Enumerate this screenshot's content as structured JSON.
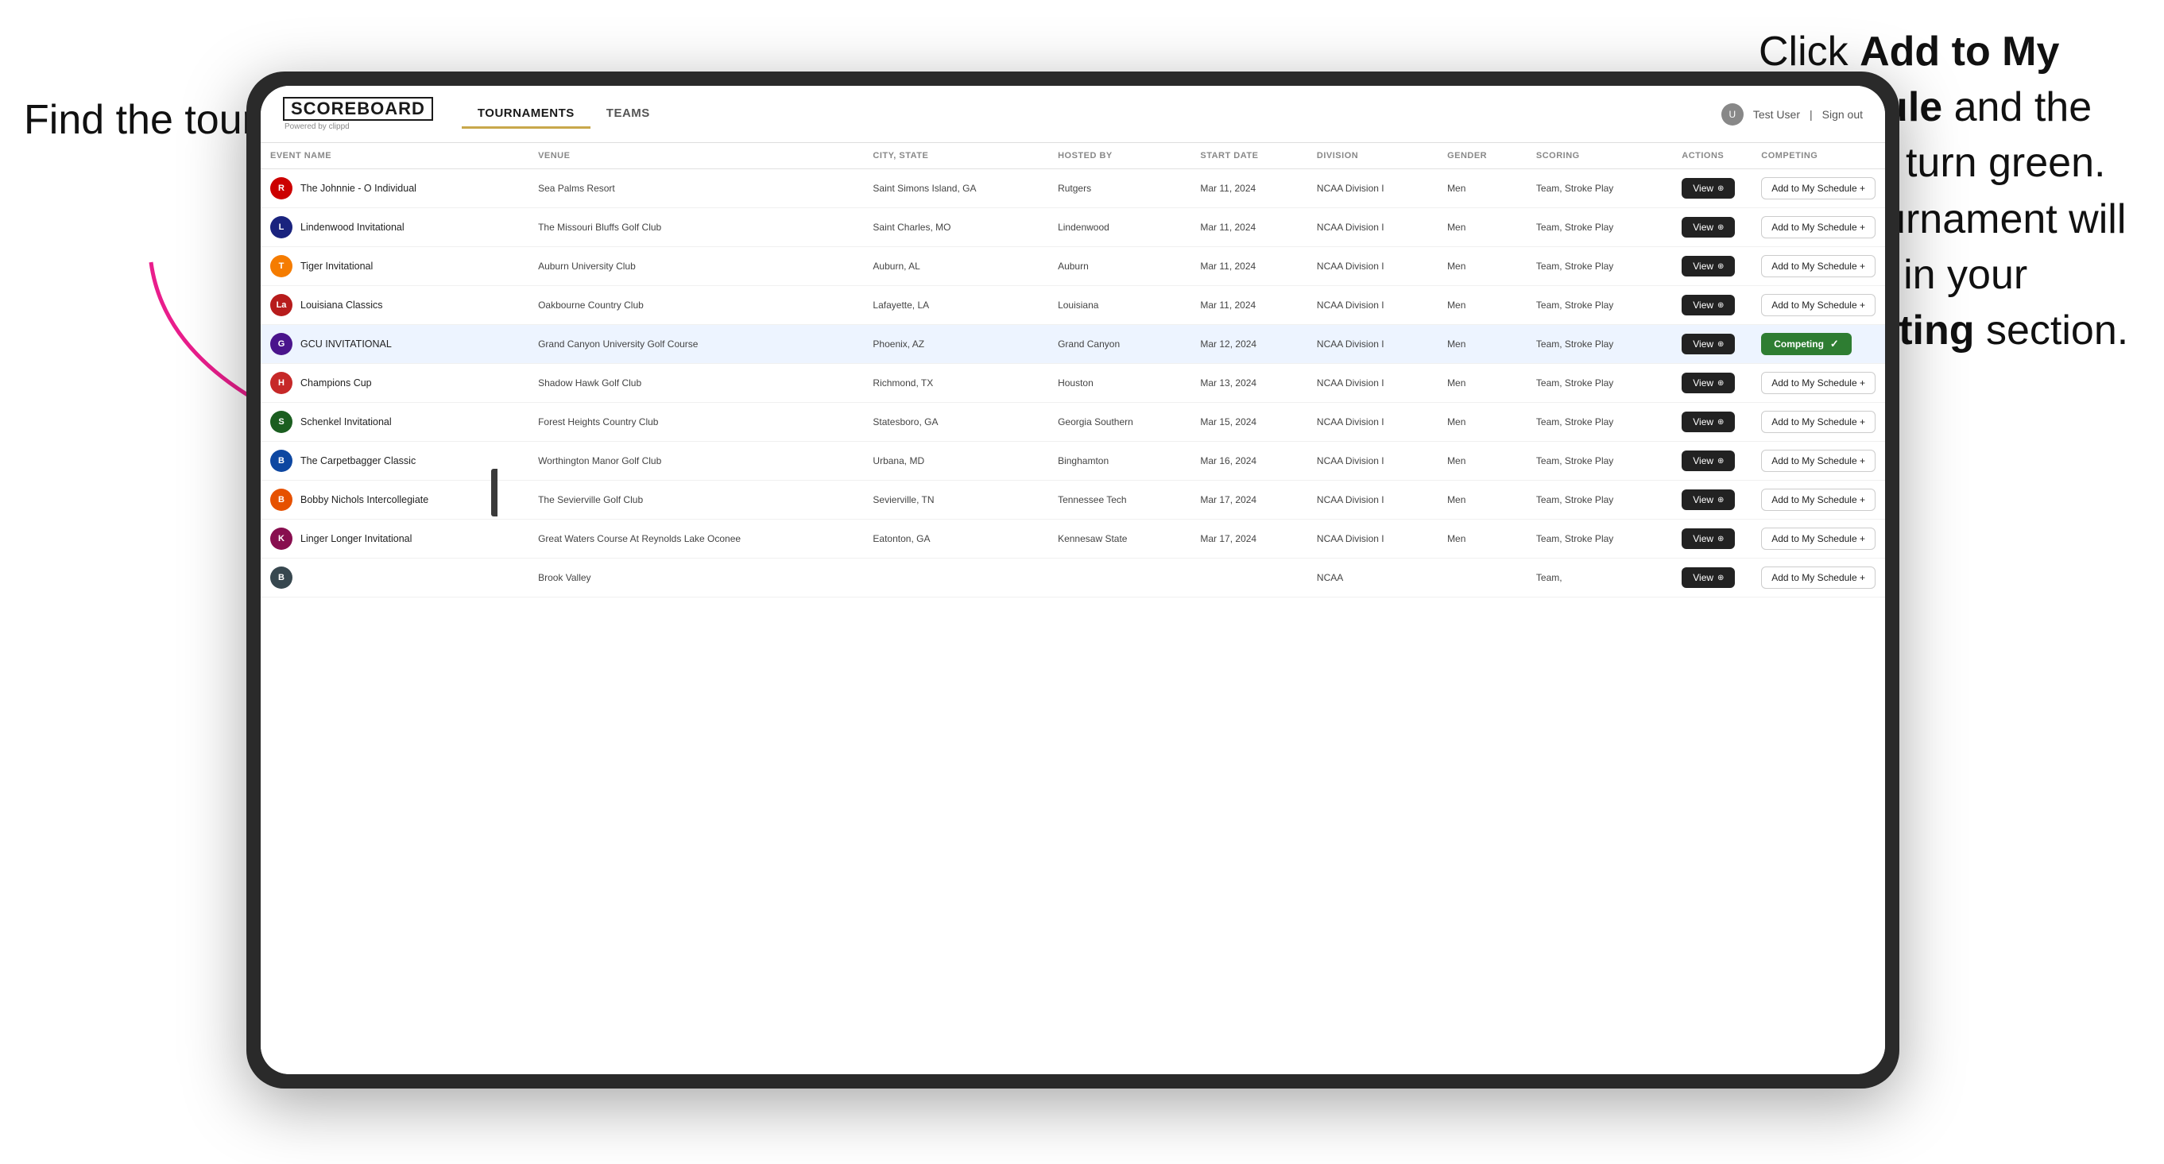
{
  "annotations": {
    "left_title": "Find the tournament.",
    "right_text_part1": "Click ",
    "right_bold1": "Add to My Schedule",
    "right_text_part2": " and the box will turn green. This tournament will now be in your ",
    "right_bold2": "Competing",
    "right_text_part3": " section."
  },
  "header": {
    "logo": "SCOREBOARD",
    "logo_sub": "Powered by clippd",
    "tabs": [
      {
        "label": "TOURNAMENTS",
        "active": true
      },
      {
        "label": "TEAMS",
        "active": false
      }
    ],
    "user_label": "Test User",
    "signout_label": "Sign out"
  },
  "table": {
    "columns": [
      "EVENT NAME",
      "VENUE",
      "CITY, STATE",
      "HOSTED BY",
      "START DATE",
      "DIVISION",
      "GENDER",
      "SCORING",
      "ACTIONS",
      "COMPETING"
    ],
    "rows": [
      {
        "id": 1,
        "logo_color": "#cc0000",
        "logo_letter": "R",
        "event_name": "The Johnnie - O Individual",
        "venue": "Sea Palms Resort",
        "city_state": "Saint Simons Island, GA",
        "hosted_by": "Rutgers",
        "start_date": "Mar 11, 2024",
        "division": "NCAA Division I",
        "gender": "Men",
        "scoring": "Team, Stroke Play",
        "action": "View",
        "competing_status": "add",
        "highlighted": false
      },
      {
        "id": 2,
        "logo_color": "#1a237e",
        "logo_letter": "L",
        "event_name": "Lindenwood Invitational",
        "venue": "The Missouri Bluffs Golf Club",
        "city_state": "Saint Charles, MO",
        "hosted_by": "Lindenwood",
        "start_date": "Mar 11, 2024",
        "division": "NCAA Division I",
        "gender": "Men",
        "scoring": "Team, Stroke Play",
        "action": "View",
        "competing_status": "add",
        "highlighted": false
      },
      {
        "id": 3,
        "logo_color": "#f57c00",
        "logo_letter": "T",
        "event_name": "Tiger Invitational",
        "venue": "Auburn University Club",
        "city_state": "Auburn, AL",
        "hosted_by": "Auburn",
        "start_date": "Mar 11, 2024",
        "division": "NCAA Division I",
        "gender": "Men",
        "scoring": "Team, Stroke Play",
        "action": "View",
        "competing_status": "add",
        "highlighted": false
      },
      {
        "id": 4,
        "logo_color": "#b71c1c",
        "logo_letter": "La",
        "event_name": "Louisiana Classics",
        "venue": "Oakbourne Country Club",
        "city_state": "Lafayette, LA",
        "hosted_by": "Louisiana",
        "start_date": "Mar 11, 2024",
        "division": "NCAA Division I",
        "gender": "Men",
        "scoring": "Team, Stroke Play",
        "action": "View",
        "competing_status": "add",
        "highlighted": false
      },
      {
        "id": 5,
        "logo_color": "#4a148c",
        "logo_letter": "G",
        "event_name": "GCU INVITATIONAL",
        "venue": "Grand Canyon University Golf Course",
        "city_state": "Phoenix, AZ",
        "hosted_by": "Grand Canyon",
        "start_date": "Mar 12, 2024",
        "division": "NCAA Division I",
        "gender": "Men",
        "scoring": "Team, Stroke Play",
        "action": "View",
        "competing_status": "competing",
        "highlighted": true
      },
      {
        "id": 6,
        "logo_color": "#c62828",
        "logo_letter": "H",
        "event_name": "Champions Cup",
        "venue": "Shadow Hawk Golf Club",
        "city_state": "Richmond, TX",
        "hosted_by": "Houston",
        "start_date": "Mar 13, 2024",
        "division": "NCAA Division I",
        "gender": "Men",
        "scoring": "Team, Stroke Play",
        "action": "View",
        "competing_status": "add",
        "highlighted": false
      },
      {
        "id": 7,
        "logo_color": "#1b5e20",
        "logo_letter": "S",
        "event_name": "Schenkel Invitational",
        "venue": "Forest Heights Country Club",
        "city_state": "Statesboro, GA",
        "hosted_by": "Georgia Southern",
        "start_date": "Mar 15, 2024",
        "division": "NCAA Division I",
        "gender": "Men",
        "scoring": "Team, Stroke Play",
        "action": "View",
        "competing_status": "add",
        "highlighted": false
      },
      {
        "id": 8,
        "logo_color": "#0d47a1",
        "logo_letter": "B",
        "event_name": "The Carpetbagger Classic",
        "venue": "Worthington Manor Golf Club",
        "city_state": "Urbana, MD",
        "hosted_by": "Binghamton",
        "start_date": "Mar 16, 2024",
        "division": "NCAA Division I",
        "gender": "Men",
        "scoring": "Team, Stroke Play",
        "action": "View",
        "competing_status": "add",
        "highlighted": false
      },
      {
        "id": 9,
        "logo_color": "#e65100",
        "logo_letter": "B",
        "event_name": "Bobby Nichols Intercollegiate",
        "venue": "The Sevierville Golf Club",
        "city_state": "Sevierville, TN",
        "hosted_by": "Tennessee Tech",
        "start_date": "Mar 17, 2024",
        "division": "NCAA Division I",
        "gender": "Men",
        "scoring": "Team, Stroke Play",
        "action": "View",
        "competing_status": "add",
        "highlighted": false
      },
      {
        "id": 10,
        "logo_color": "#880e4f",
        "logo_letter": "K",
        "event_name": "Linger Longer Invitational",
        "venue": "Great Waters Course At Reynolds Lake Oconee",
        "city_state": "Eatonton, GA",
        "hosted_by": "Kennesaw State",
        "start_date": "Mar 17, 2024",
        "division": "NCAA Division I",
        "gender": "Men",
        "scoring": "Team, Stroke Play",
        "action": "View",
        "competing_status": "add",
        "highlighted": false
      },
      {
        "id": 11,
        "logo_color": "#37474f",
        "logo_letter": "B",
        "event_name": "",
        "venue": "Brook Valley",
        "city_state": "",
        "hosted_by": "",
        "start_date": "",
        "division": "NCAA",
        "gender": "",
        "scoring": "Team,",
        "action": "View",
        "competing_status": "add",
        "highlighted": false
      }
    ],
    "add_label": "Add to My Schedule +",
    "competing_label": "Competing ✓",
    "view_label": "View"
  }
}
